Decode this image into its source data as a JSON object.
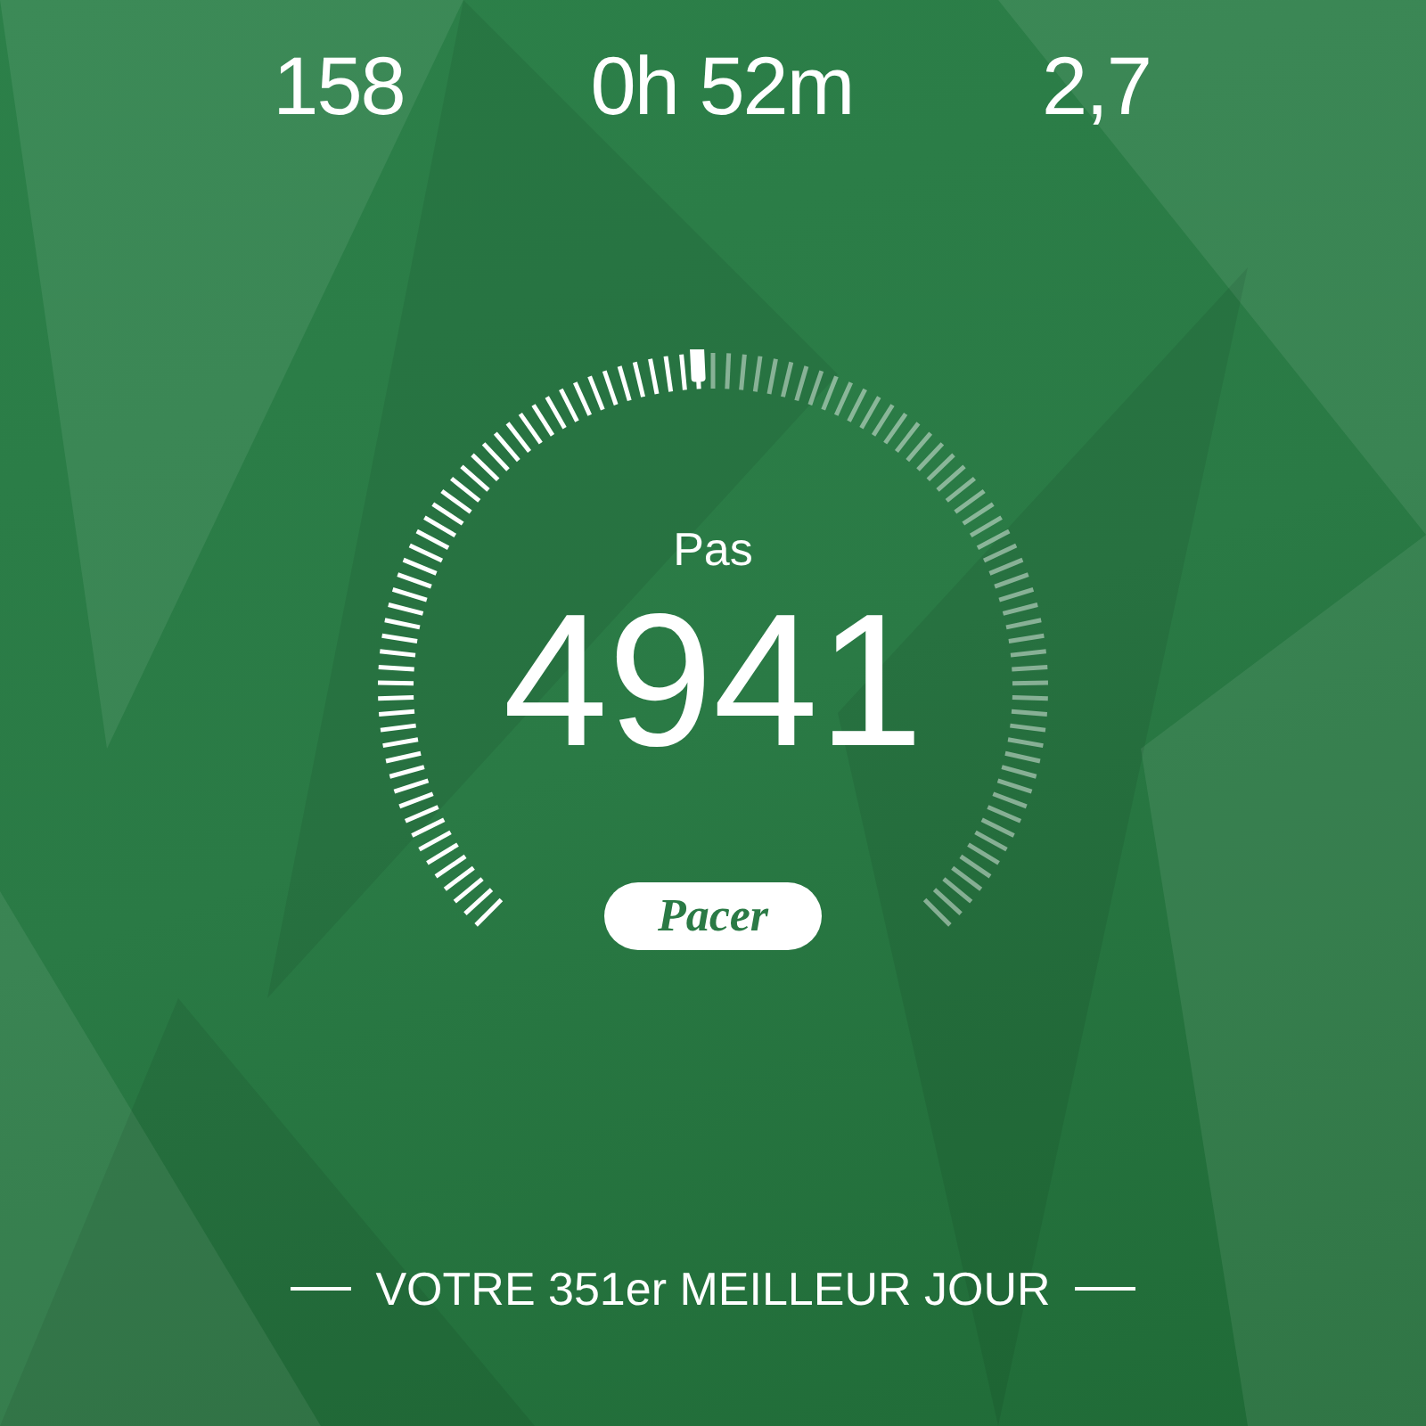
{
  "stats": [
    {
      "value": "158"
    },
    {
      "value": "0h 52m"
    },
    {
      "value": "2,7"
    }
  ],
  "steps": {
    "label": "Pas",
    "value": "4941"
  },
  "brand": "Pacer",
  "footer": "VOTRE 351er MEILLEUR JOUR"
}
